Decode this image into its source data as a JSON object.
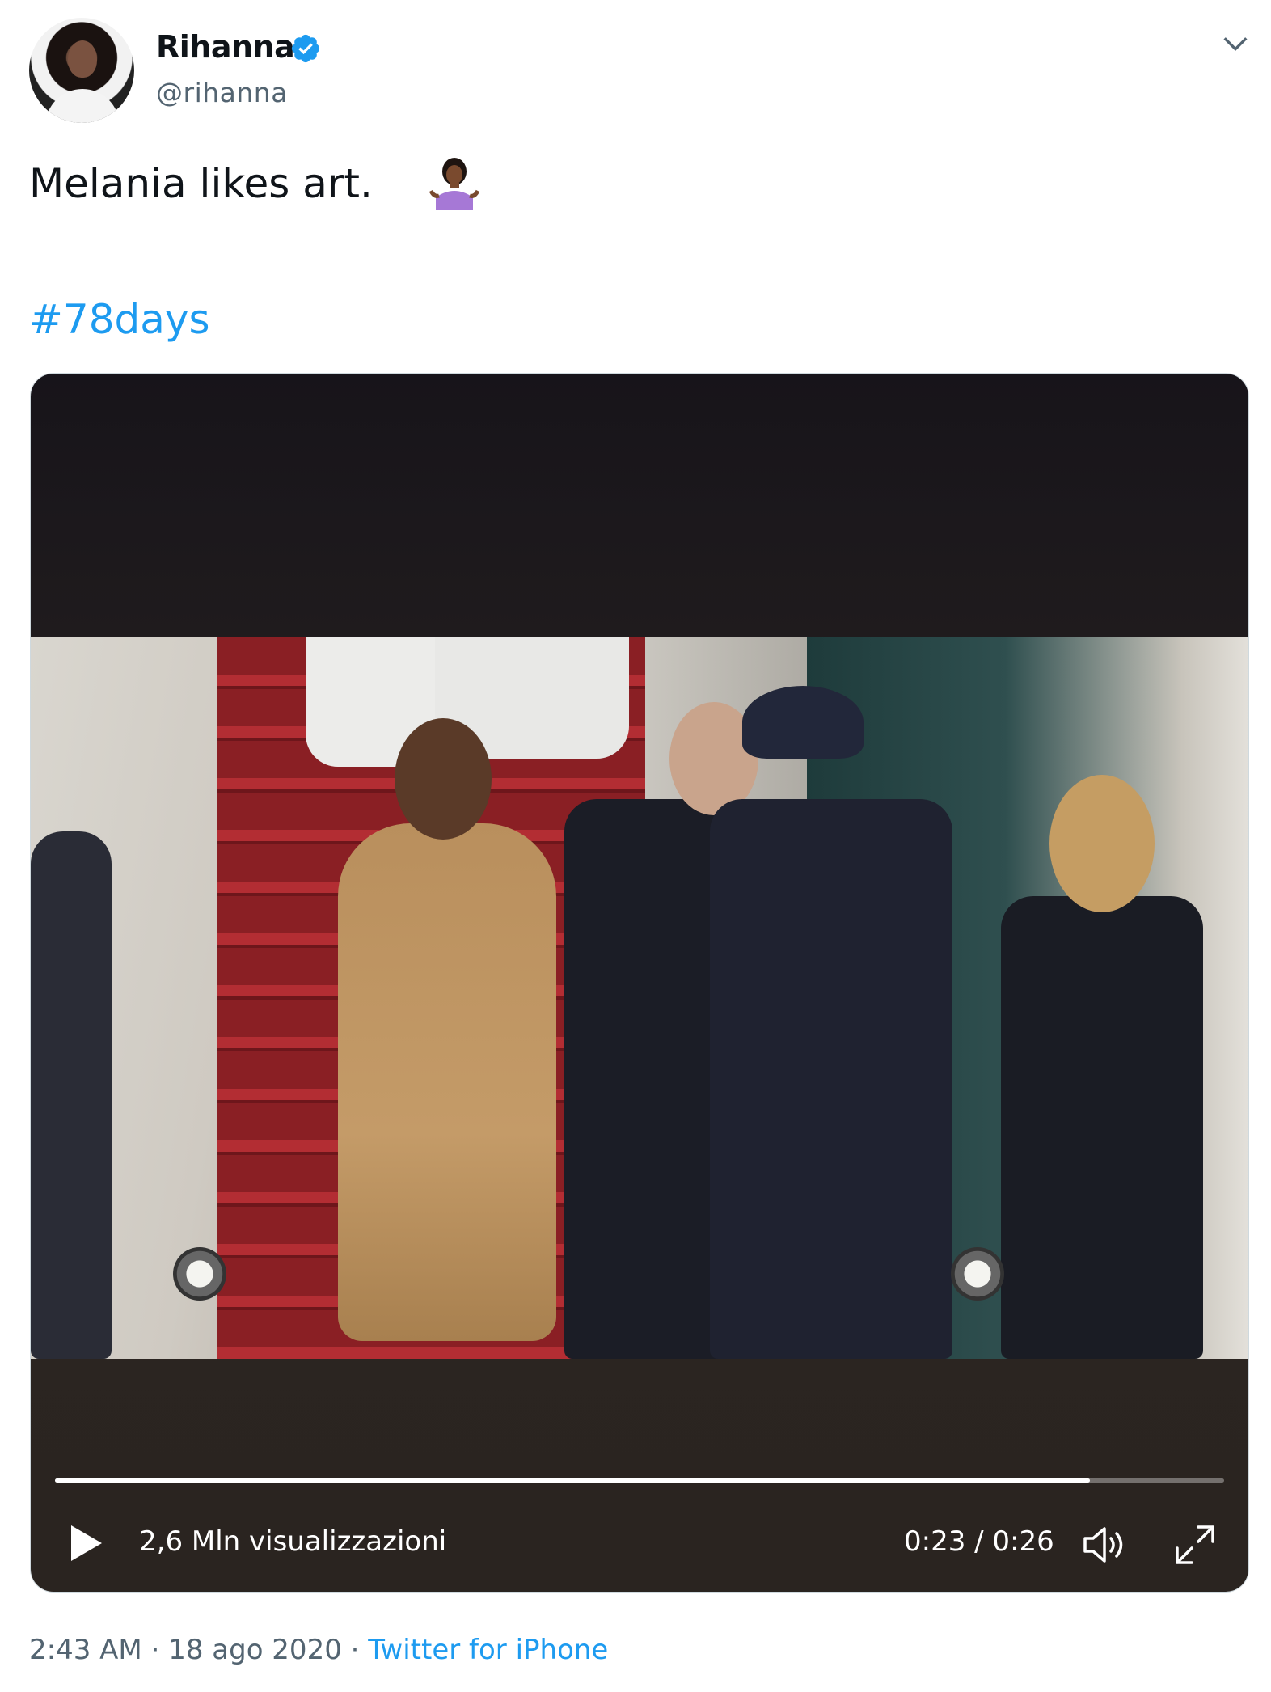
{
  "author": {
    "name": "Rihanna",
    "handle": "@rihanna",
    "verified": true
  },
  "tweet": {
    "text": "Melania likes art.",
    "emoji": "person-shrugging-emoji",
    "hashtag": "#78days"
  },
  "video": {
    "views": "2,6 Mln visualizzazioni",
    "time": "0:23 / 0:26",
    "progress": 0.885
  },
  "footer": {
    "time": "2:43 AM",
    "separator1": "·",
    "date": "18 ago 2020",
    "separator2": "·",
    "source": "Twitter for iPhone"
  },
  "colors": {
    "link": "#1d9bf0",
    "secondary_text": "#536471",
    "verified": "#1d9bf0"
  },
  "icons": [
    "chevron-down-icon",
    "verified-badge-icon",
    "play-icon",
    "volume-icon",
    "fullscreen-icon"
  ]
}
